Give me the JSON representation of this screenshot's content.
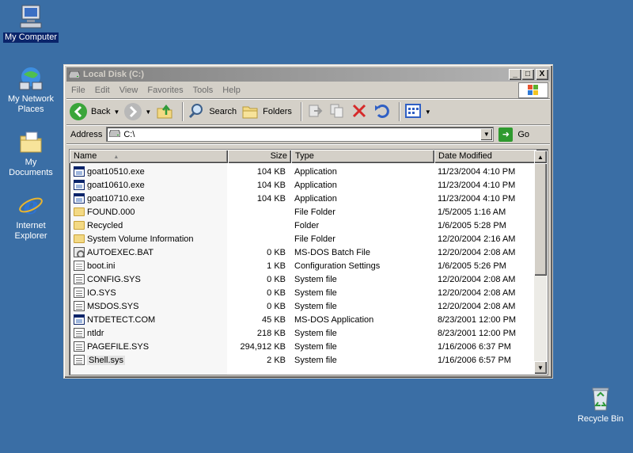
{
  "desktop": {
    "icons": [
      {
        "label": "My Computer"
      },
      {
        "label": "My Network Places"
      },
      {
        "label": "My Documents"
      },
      {
        "label": "Internet Explorer"
      },
      {
        "label": "Recycle Bin"
      }
    ]
  },
  "window": {
    "title": "Local Disk (C:)",
    "controls": {
      "minimize": "_",
      "maximize": "□",
      "close": "X"
    }
  },
  "menu": [
    "File",
    "Edit",
    "View",
    "Favorites",
    "Tools",
    "Help"
  ],
  "toolbar": {
    "back": "Back",
    "search": "Search",
    "folders": "Folders"
  },
  "address": {
    "label": "Address",
    "value": "C:\\",
    "go": "Go"
  },
  "columns": {
    "name": "Name",
    "size": "Size",
    "type": "Type",
    "date": "Date Modified"
  },
  "files": [
    {
      "name": "goat10510.exe",
      "size": "104 KB",
      "type": "Application",
      "date": "11/23/2004 4:10 PM",
      "icon": "app"
    },
    {
      "name": "goat10610.exe",
      "size": "104 KB",
      "type": "Application",
      "date": "11/23/2004 4:10 PM",
      "icon": "app"
    },
    {
      "name": "goat10710.exe",
      "size": "104 KB",
      "type": "Application",
      "date": "11/23/2004 4:10 PM",
      "icon": "app"
    },
    {
      "name": "FOUND.000",
      "size": "",
      "type": "File Folder",
      "date": "1/5/2005 1:16 AM",
      "icon": "folder"
    },
    {
      "name": "Recycled",
      "size": "",
      "type": "Folder",
      "date": "1/6/2005 5:28 PM",
      "icon": "folder"
    },
    {
      "name": "System Volume Information",
      "size": "",
      "type": "File Folder",
      "date": "12/20/2004 2:16 AM",
      "icon": "folder"
    },
    {
      "name": "AUTOEXEC.BAT",
      "size": "0 KB",
      "type": "MS-DOS Batch File",
      "date": "12/20/2004 2:08 AM",
      "icon": "bat"
    },
    {
      "name": "boot.ini",
      "size": "1 KB",
      "type": "Configuration Settings",
      "date": "1/6/2005 5:26 PM",
      "icon": "doc"
    },
    {
      "name": "CONFIG.SYS",
      "size": "0 KB",
      "type": "System file",
      "date": "12/20/2004 2:08 AM",
      "icon": "sys"
    },
    {
      "name": "IO.SYS",
      "size": "0 KB",
      "type": "System file",
      "date": "12/20/2004 2:08 AM",
      "icon": "sys"
    },
    {
      "name": "MSDOS.SYS",
      "size": "0 KB",
      "type": "System file",
      "date": "12/20/2004 2:08 AM",
      "icon": "sys"
    },
    {
      "name": "NTDETECT.COM",
      "size": "45 KB",
      "type": "MS-DOS Application",
      "date": "8/23/2001 12:00 PM",
      "icon": "app"
    },
    {
      "name": "ntldr",
      "size": "218 KB",
      "type": "System file",
      "date": "8/23/2001 12:00 PM",
      "icon": "sys"
    },
    {
      "name": "PAGEFILE.SYS",
      "size": "294,912 KB",
      "type": "System file",
      "date": "1/16/2006 6:37 PM",
      "icon": "sys"
    },
    {
      "name": "Shell.sys",
      "size": "2 KB",
      "type": "System file",
      "date": "1/16/2006 6:57 PM",
      "icon": "sys"
    }
  ],
  "colors": {
    "desktop": "#3a6ea5",
    "selection": "#0a246a",
    "chrome": "#d4d0c8"
  }
}
